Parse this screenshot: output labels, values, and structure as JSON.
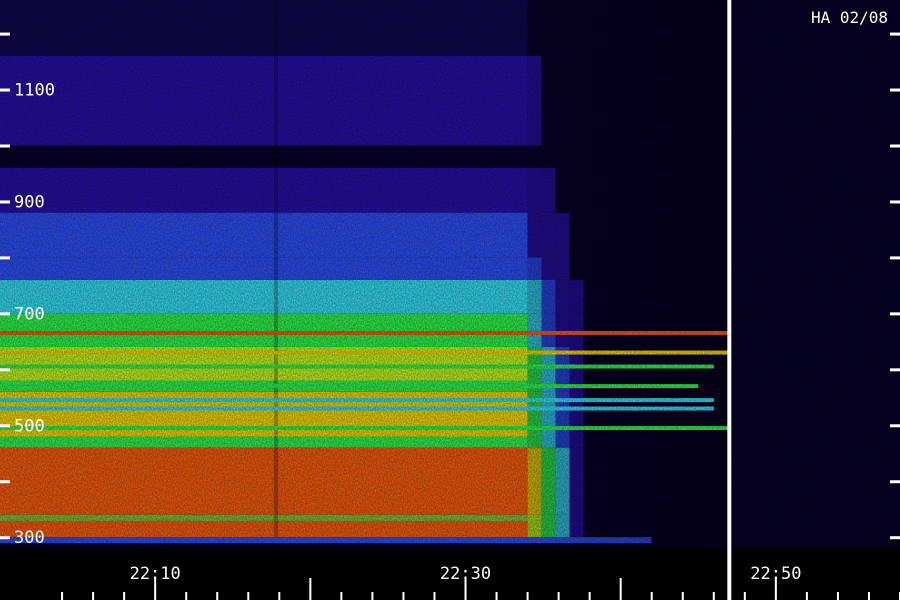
{
  "title": "HA 02/08",
  "chart_data": {
    "type": "heatmap",
    "title": "HA 02/08",
    "xlabel": "",
    "ylabel": "",
    "x_range": [
      "22:00",
      "22:58"
    ],
    "y_range": [
      295,
      1260
    ],
    "x_tick_labels": [
      "22:10",
      "22:30",
      "22:50"
    ],
    "y_tick_labels": [
      "1100",
      "900",
      "700",
      "500",
      "300"
    ],
    "y_ticks_all": [
      300,
      400,
      500,
      600,
      700,
      800,
      900,
      1000,
      1100,
      1200
    ],
    "time_marker": "22:47",
    "colormap": [
      "#06002a",
      "#2a10b0",
      "#2e52ff",
      "#38e6ff",
      "#32ff50",
      "#c8ff20",
      "#ffe000",
      "#ff6010",
      "#ff1000"
    ],
    "regions": [
      {
        "y": [
          300,
          340
        ],
        "x_end": "22:34",
        "level": 0.85
      },
      {
        "y": [
          340,
          460
        ],
        "x_end": "22:34",
        "level": 0.9
      },
      {
        "y": [
          460,
          480
        ],
        "x_end": "22:34",
        "level": 0.55
      },
      {
        "y": [
          480,
          560
        ],
        "x_end": "22:34",
        "level": 0.7
      },
      {
        "y": [
          560,
          580
        ],
        "x_end": "22:34",
        "level": 0.55
      },
      {
        "y": [
          580,
          640
        ],
        "x_end": "22:34",
        "level": 0.62
      },
      {
        "y": [
          640,
          700
        ],
        "x_end": "22:34",
        "level": 0.45
      },
      {
        "y": [
          700,
          760
        ],
        "x_end": "22:34",
        "level": 0.42
      },
      {
        "y": [
          760,
          800
        ],
        "x_end": "22:34",
        "level": 0.3
      },
      {
        "y": [
          800,
          880
        ],
        "x_end": "22:34",
        "level": 0.2
      },
      {
        "y": [
          880,
          960
        ],
        "x_end": "22:34",
        "level": 0.12
      },
      {
        "y": [
          1000,
          1160
        ],
        "x_end": "22:34",
        "level": 0.08
      }
    ],
    "emission_lines": [
      {
        "y": 665,
        "x_end": "22:47",
        "level": 0.82
      },
      {
        "y": 630,
        "x_end": "22:47",
        "level": 0.78
      },
      {
        "y": 605,
        "x_end": "22:46",
        "level": 0.55
      },
      {
        "y": 570,
        "x_end": "22:45",
        "level": 0.45
      },
      {
        "y": 545,
        "x_end": "22:46",
        "level": 0.35
      },
      {
        "y": 530,
        "x_end": "22:46",
        "level": 0.32
      },
      {
        "y": 495,
        "x_end": "22:47",
        "level": 0.55
      }
    ]
  }
}
